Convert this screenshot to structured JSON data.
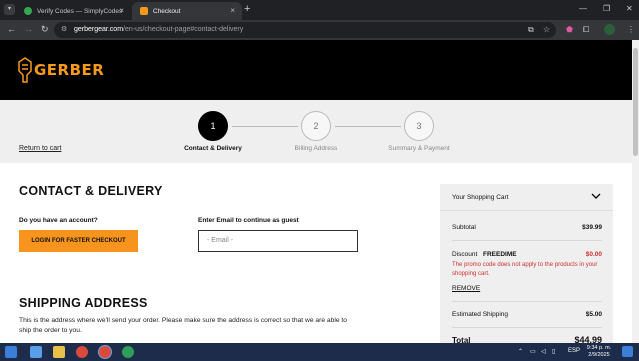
{
  "browser": {
    "tabs": [
      {
        "title": "Verify Codes — SimplyCodes",
        "active": false
      },
      {
        "title": "Checkout",
        "active": true
      }
    ],
    "url_host": "gerbergear.com",
    "url_path": "/en-us/checkout-page#contact-delivery",
    "new_tab_glyph": "+",
    "close_glyph": "×"
  },
  "site": {
    "logo_text": "GERBER",
    "brand_color": "#f59a1b"
  },
  "steps": [
    {
      "number": "1",
      "label": "Contact & Delivery",
      "active": true
    },
    {
      "number": "2",
      "label": "Billing Address",
      "active": false
    },
    {
      "number": "3",
      "label": "Summary & Payment",
      "active": false
    }
  ],
  "return_to_cart": "Return to cart",
  "contact": {
    "title": "CONTACT & DELIVERY",
    "account_question": "Do you have an account?",
    "login_button": "LOGIN FOR FASTER CHECKOUT",
    "guest_label": "Enter Email to continue as guest",
    "email_placeholder": "- Email -"
  },
  "shipping": {
    "title": "SHIPPING ADDRESS",
    "description": "This is the address where we'll send your order. Please make sure the address is correct so that we are able to ship the order to you."
  },
  "cart": {
    "title": "Your Shopping Cart",
    "subtotal_label": "Subtotal",
    "subtotal_value": "$39.99",
    "discount_label": "Discount",
    "discount_code": "FREEDIME",
    "discount_value": "$0.00",
    "promo_message": "The promo code does not apply to the products in your shopping cart.",
    "remove_label": "REMOVE",
    "shipping_label": "Estimated Shipping",
    "shipping_value": "$5.00",
    "total_label": "Total",
    "total_value": "$44.99",
    "error_color": "#d0312d"
  },
  "taskbar": {
    "language": "ESP",
    "time": "9:34 p. m.",
    "date": "2/9/2025"
  }
}
